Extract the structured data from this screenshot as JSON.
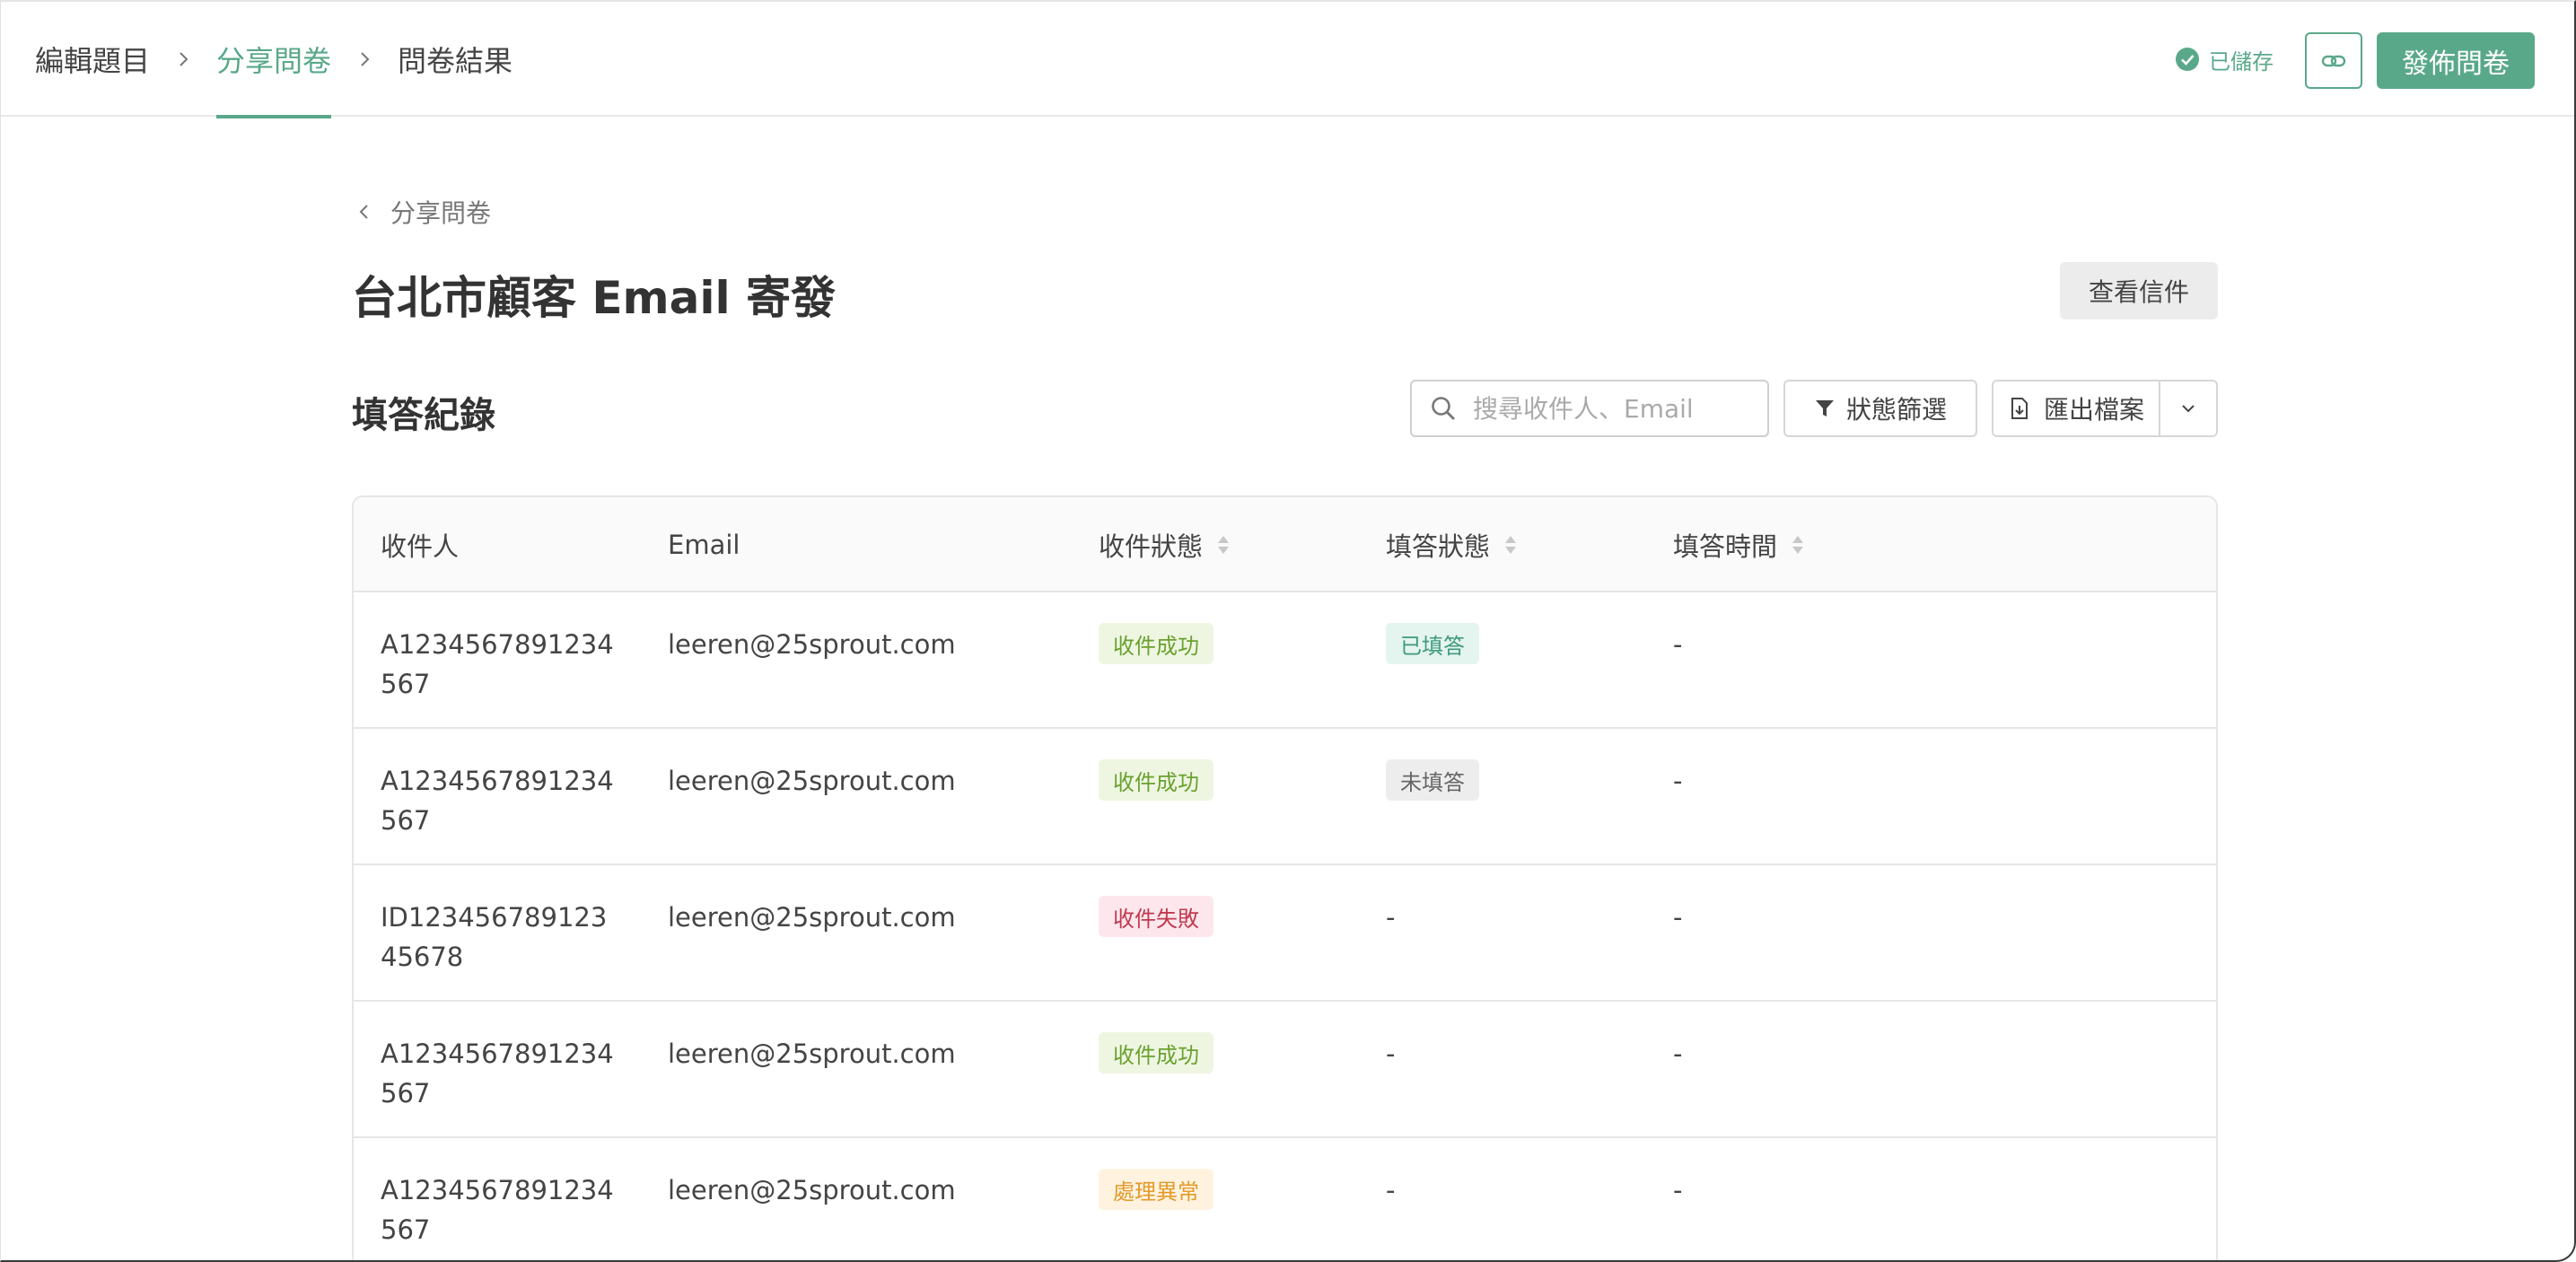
{
  "colors": {
    "accent": "#5aa88a",
    "success": "#6aa12e",
    "fail": "#c0394f",
    "warn": "#e39a2a"
  },
  "steps": [
    {
      "label": "編輯題目",
      "active": false
    },
    {
      "label": "分享問卷",
      "active": true
    },
    {
      "label": "問卷結果",
      "active": false
    }
  ],
  "header": {
    "saved_label": "已儲存",
    "link_icon": "link-icon",
    "publish_label": "發佈問卷"
  },
  "back": {
    "label": "分享問卷"
  },
  "page": {
    "title": "台北市顧客 Email 寄發",
    "view_mail_label": "查看信件"
  },
  "section": {
    "title": "填答紀錄",
    "search_placeholder": "搜尋收件人、Email",
    "filter_label": "狀態篩選",
    "export_label": "匯出檔案"
  },
  "table": {
    "columns": [
      "收件人",
      "Email",
      "收件狀態",
      "填答狀態",
      "填答時間"
    ],
    "rows": [
      {
        "recipient": "A1234567891234567",
        "email": "leeren@25sprout.com",
        "delivery": "收件成功",
        "delivery_type": "success",
        "response": "已填答",
        "response_type": "done",
        "time": "-"
      },
      {
        "recipient": "A1234567891234567",
        "email": "leeren@25sprout.com",
        "delivery": "收件成功",
        "delivery_type": "success",
        "response": "未填答",
        "response_type": "pending",
        "time": "-"
      },
      {
        "recipient": "ID12345678912345678",
        "email": "leeren@25sprout.com",
        "delivery": "收件失敗",
        "delivery_type": "fail",
        "response": "-",
        "response_type": "none",
        "time": "-"
      },
      {
        "recipient": "A1234567891234567",
        "email": "leeren@25sprout.com",
        "delivery": "收件成功",
        "delivery_type": "success",
        "response": "-",
        "response_type": "none",
        "time": "-"
      },
      {
        "recipient": "A1234567891234567",
        "email": "leeren@25sprout.com",
        "delivery": "處理異常",
        "delivery_type": "warn",
        "response": "-",
        "response_type": "none",
        "time": "-"
      }
    ]
  }
}
